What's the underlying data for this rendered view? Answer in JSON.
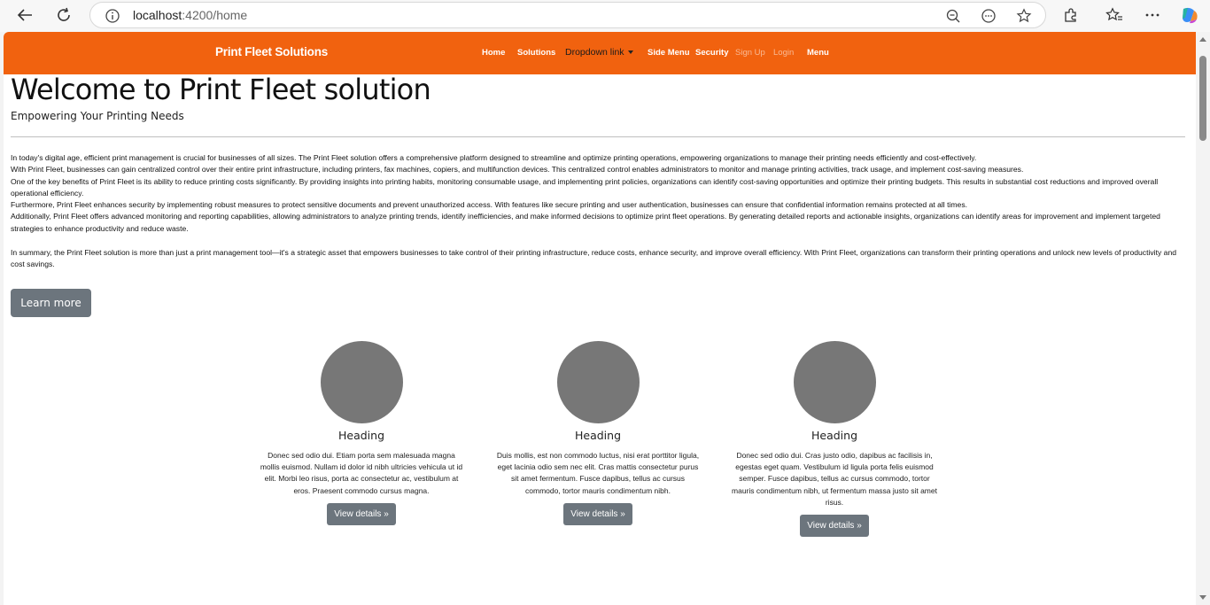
{
  "browser": {
    "url_host": "localhost",
    "url_rest": ":4200/home"
  },
  "navbar": {
    "brand": "Print Fleet Solutions",
    "links": {
      "home": "Home",
      "solutions": "Solutions",
      "dropdown": "Dropdown link",
      "side_menu": "Side Menu",
      "security": "Security",
      "sign_up": "Sign Up",
      "login": "Login",
      "menu": "Menu"
    },
    "color": "#f1620f"
  },
  "hero": {
    "title": "Welcome to Print Fleet solution",
    "subtitle": "Empowering Your Printing Needs",
    "paragraphs": [
      "In today's digital age, efficient print management is crucial for businesses of all sizes. The Print Fleet solution offers a comprehensive platform designed to streamline and optimize printing operations, empowering organizations to manage their printing needs efficiently and cost-effectively.",
      "With Print Fleet, businesses can gain centralized control over their entire print infrastructure, including printers, fax machines, copiers, and multifunction devices. This centralized control enables administrators to monitor and manage printing activities, track usage, and implement cost-saving measures.",
      "One of the key benefits of Print Fleet is its ability to reduce printing costs significantly. By providing insights into printing habits, monitoring consumable usage, and implementing print policies, organizations can identify cost-saving opportunities and optimize their printing budgets. This results in substantial cost reductions and improved overall operational efficiency.",
      "Furthermore, Print Fleet enhances security by implementing robust measures to protect sensitive documents and prevent unauthorized access. With features like secure printing and user authentication, businesses can ensure that confidential information remains protected at all times.",
      "Additionally, Print Fleet offers advanced monitoring and reporting capabilities, allowing administrators to analyze printing trends, identify inefficiencies, and make informed decisions to optimize print fleet operations. By generating detailed reports and actionable insights, organizations can identify areas for improvement and implement targeted strategies to enhance productivity and reduce waste.",
      "In summary, the Print Fleet solution is more than just a print management tool—it's a strategic asset that empowers businesses to take control of their printing infrastructure, reduce costs, enhance security, and improve overall efficiency. With Print Fleet, organizations can transform their printing operations and unlock new levels of productivity and cost savings."
    ],
    "learn_more": "Learn more"
  },
  "features": [
    {
      "heading": "Heading",
      "text": "Donec sed odio dui. Etiam porta sem malesuada magna mollis euismod. Nullam id dolor id nibh ultricies vehicula ut id elit. Morbi leo risus, porta ac consectetur ac, vestibulum at eros. Praesent commodo cursus magna.",
      "button": "View details »"
    },
    {
      "heading": "Heading",
      "text": "Duis mollis, est non commodo luctus, nisi erat porttitor ligula, eget lacinia odio sem nec elit. Cras mattis consectetur purus sit amet fermentum. Fusce dapibus, tellus ac cursus commodo, tortor mauris condimentum nibh.",
      "button": "View details »"
    },
    {
      "heading": "Heading",
      "text": "Donec sed odio dui. Cras justo odio, dapibus ac facilisis in, egestas eget quam. Vestibulum id ligula porta felis euismod semper. Fusce dapibus, tellus ac cursus commodo, tortor mauris condimentum nibh, ut fermentum massa justo sit amet risus.",
      "button": "View details »"
    }
  ]
}
